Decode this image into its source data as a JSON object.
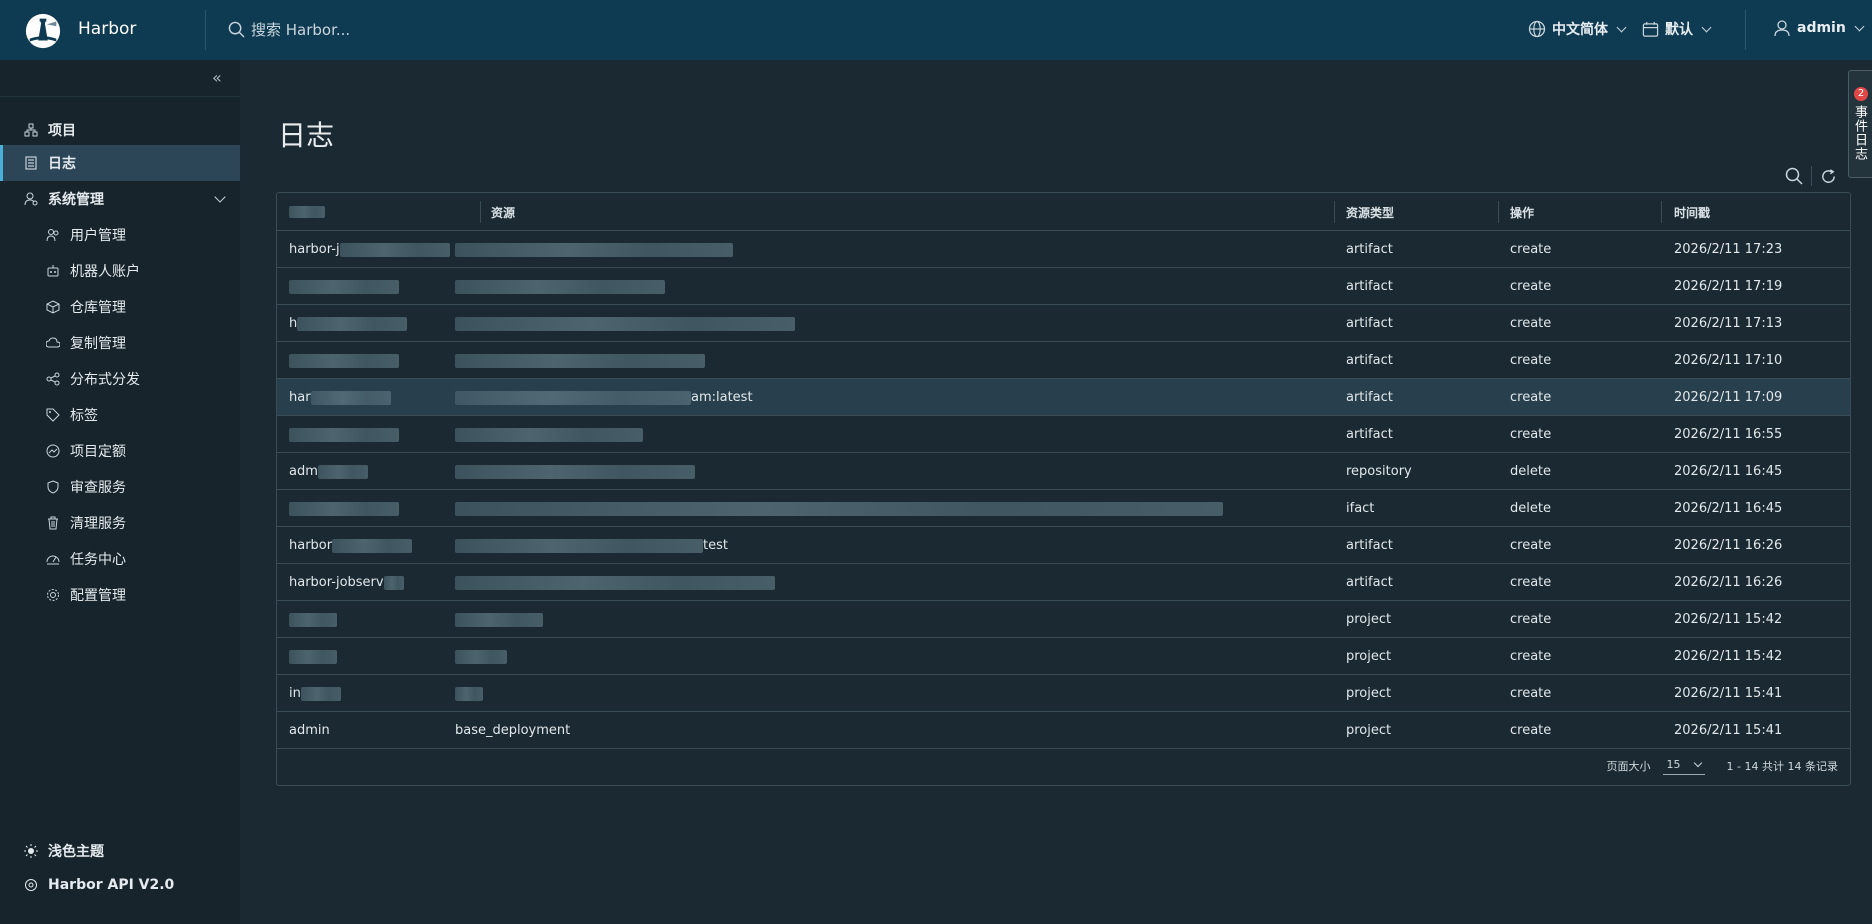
{
  "header": {
    "brand": "Harbor",
    "search_placeholder": "搜索 Harbor...",
    "language": "中文简体",
    "date_format": "默认",
    "user": "admin"
  },
  "sidebar": {
    "items": [
      {
        "label": "项目",
        "icon": "projects-icon"
      },
      {
        "label": "日志",
        "icon": "logs-icon",
        "active": true
      },
      {
        "label": "系统管理",
        "icon": "admin-icon"
      }
    ],
    "sub_items": [
      {
        "label": "用户管理",
        "icon": "users-icon"
      },
      {
        "label": "机器人账户",
        "icon": "robot-icon"
      },
      {
        "label": "仓库管理",
        "icon": "registry-icon"
      },
      {
        "label": "复制管理",
        "icon": "replication-icon"
      },
      {
        "label": "分布式分发",
        "icon": "distribution-icon"
      },
      {
        "label": "标签",
        "icon": "tag-icon"
      },
      {
        "label": "项目定额",
        "icon": "quota-icon"
      },
      {
        "label": "审查服务",
        "icon": "shield-icon"
      },
      {
        "label": "清理服务",
        "icon": "trash-icon"
      },
      {
        "label": "任务中心",
        "icon": "dashboard-icon"
      },
      {
        "label": "配置管理",
        "icon": "gear-icon"
      }
    ],
    "theme_toggle": "浅色主题",
    "api_link": "Harbor API V2.0"
  },
  "page": {
    "title": "日志"
  },
  "table": {
    "columns": [
      "资源",
      "资源类型",
      "操作",
      "时间戳"
    ],
    "rows": [
      {
        "user": "harbor-j",
        "resource": "",
        "type": "artifact",
        "op": "create",
        "time": "2026/2/11 17:23"
      },
      {
        "user": "",
        "resource": "",
        "type": "artifact",
        "op": "create",
        "time": "2026/2/11 17:19"
      },
      {
        "user": "h",
        "resource": "",
        "type": "artifact",
        "op": "create",
        "time": "2026/2/11 17:13"
      },
      {
        "user": "",
        "resource": "",
        "type": "artifact",
        "op": "create",
        "time": "2026/2/11 17:10"
      },
      {
        "user": "har",
        "resource": "am:latest",
        "type": "artifact",
        "op": "create",
        "time": "2026/2/11 17:09"
      },
      {
        "user": "",
        "resource": "",
        "type": "artifact",
        "op": "create",
        "time": "2026/2/11 16:55"
      },
      {
        "user": "adm",
        "resource": "",
        "type": "repository",
        "op": "delete",
        "time": "2026/2/11 16:45"
      },
      {
        "user": "",
        "resource": "",
        "type": "ifact",
        "op": "delete",
        "time": "2026/2/11 16:45"
      },
      {
        "user": "harbor",
        "resource": "test",
        "type": "artifact",
        "op": "create",
        "time": "2026/2/11 16:26"
      },
      {
        "user": "harbor-jobserv",
        "resource": "",
        "type": "artifact",
        "op": "create",
        "time": "2026/2/11 16:26"
      },
      {
        "user": "",
        "resource": "",
        "type": "project",
        "op": "create",
        "time": "2026/2/11 15:42"
      },
      {
        "user": "",
        "resource": "",
        "type": "project",
        "op": "create",
        "time": "2026/2/11 15:42"
      },
      {
        "user": "in",
        "resource": "",
        "type": "project",
        "op": "create",
        "time": "2026/2/11 15:41"
      },
      {
        "user": "admin",
        "resource": "base_deployment",
        "type": "project",
        "op": "create",
        "time": "2026/2/11 15:41"
      }
    ],
    "page_size_label": "页面大小",
    "page_size": "15",
    "summary": "1 - 14 共计 14 条记录"
  },
  "event_tab": {
    "label": "事件日志",
    "count": "2"
  },
  "colors": {
    "header_bg": "#0e3a52",
    "sidebar_bg": "#17242b",
    "main_bg": "#1b2a32",
    "active_bg": "#2c4658",
    "accent": "#49afd9"
  }
}
